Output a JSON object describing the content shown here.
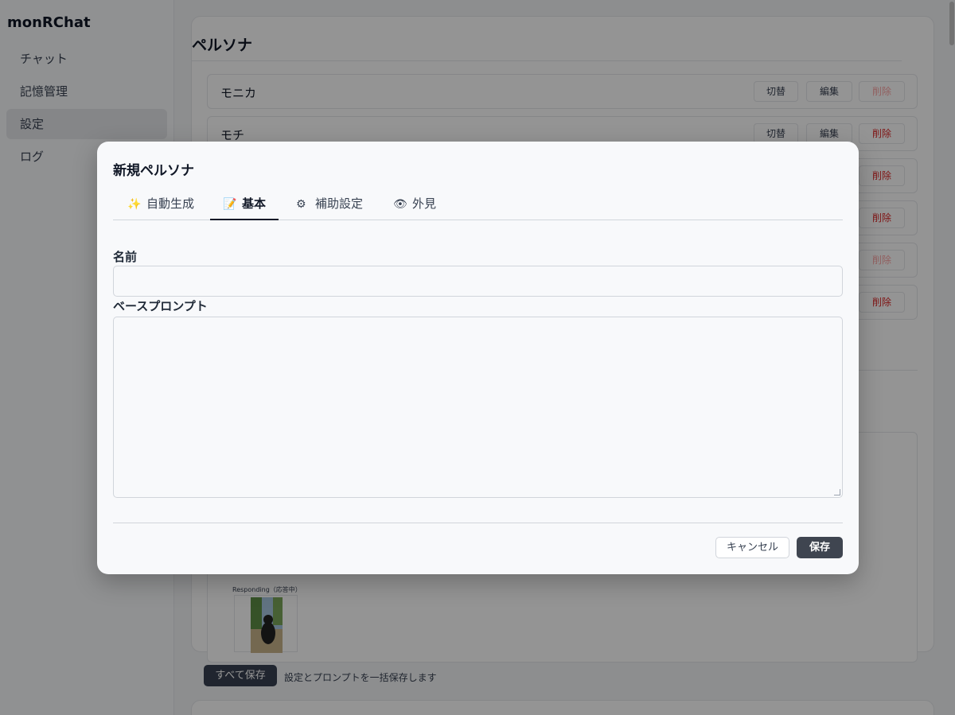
{
  "app": {
    "brand": "monRChat"
  },
  "sidebar": {
    "items": [
      {
        "label": "チャット",
        "active": false
      },
      {
        "label": "記憶管理",
        "active": false
      },
      {
        "label": "設定",
        "active": true
      },
      {
        "label": "ログ",
        "active": false
      }
    ]
  },
  "main": {
    "card_title": "ペルソナ",
    "personas": [
      {
        "name": "モニカ",
        "switch": "切替",
        "edit": "編集",
        "delete": "削除",
        "delete_disabled": true
      },
      {
        "name": "モチ",
        "switch": "切替",
        "edit": "編集",
        "delete": "削除",
        "delete_disabled": false
      }
    ],
    "hidden_rows_delete": [
      {
        "delete": "削除",
        "delete_disabled": false
      },
      {
        "delete": "削除",
        "delete_disabled": false
      },
      {
        "delete": "削除",
        "delete_disabled": true
      },
      {
        "delete": "削除",
        "delete_disabled": false
      }
    ],
    "responding_label": "Responding（応答中）",
    "save_all_label": "すべて保存",
    "save_note": "設定とプロンプトを一括保存します"
  },
  "modal": {
    "title": "新規ペルソナ",
    "tabs": [
      {
        "icon": "sparkles-icon",
        "glyph": "✨",
        "label": "自動生成",
        "active": false
      },
      {
        "icon": "memo-icon",
        "glyph": "📝",
        "label": "基本",
        "active": true
      },
      {
        "icon": "gear-icon",
        "glyph": "⚙",
        "label": "補助設定",
        "active": false
      },
      {
        "icon": "eye-icon",
        "glyph": "👁",
        "label": "外見",
        "active": false
      }
    ],
    "fields": {
      "name_label": "名前",
      "name_value": "",
      "prompt_label": "ベースプロンプト",
      "prompt_value": ""
    },
    "buttons": {
      "cancel": "キャンセル",
      "save": "保存"
    }
  },
  "colors": {
    "accent_dark": "#3f4550",
    "danger": "#dc2626",
    "danger_disabled": "#fca5a5"
  }
}
